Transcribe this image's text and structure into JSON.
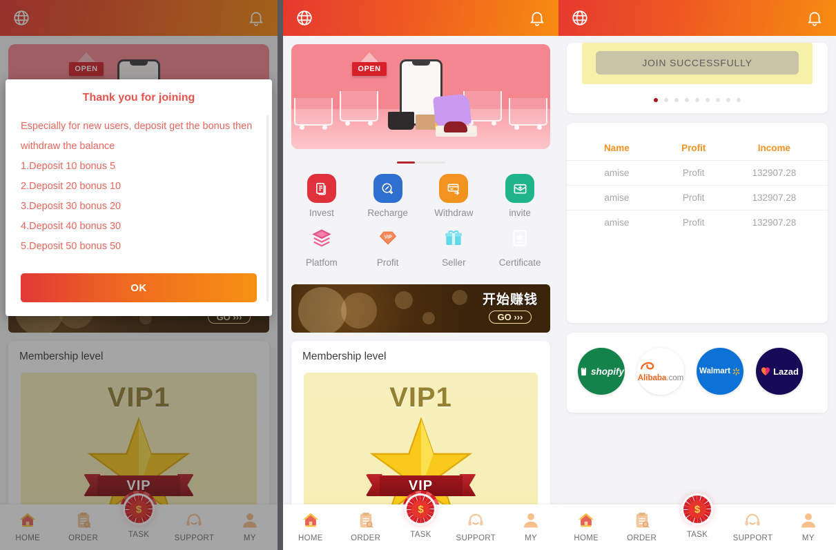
{
  "app": {
    "header": {
      "globe_icon": "globe-icon",
      "bell_icon": "bell-icon"
    },
    "bottom_nav": [
      {
        "label": "HOME",
        "icon": "home-icon"
      },
      {
        "label": "ORDER",
        "icon": "clipboard-icon"
      },
      {
        "label": "TASK",
        "icon": "poker-chip-icon"
      },
      {
        "label": "SUPPORT",
        "icon": "headset-icon"
      },
      {
        "label": "MY",
        "icon": "person-icon"
      }
    ]
  },
  "modal": {
    "title": "Thank you for joining",
    "intro": "Especially for new users, deposit get the bonus then withdraw the balance",
    "lines": [
      "1.Deposit 10 bonus 5",
      "2.Deposit 20 bonus 10",
      "3.Deposit 30 bonus 20",
      "4.Deposit 40 bonus 30",
      "5.Deposit 50 bonus 50"
    ],
    "ok_label": "OK"
  },
  "home": {
    "hero": {
      "open_sign": "OPEN",
      "alt": "pink shopping carts and phone banner"
    },
    "carousel": {
      "active_index": 0,
      "total": 2
    },
    "quick_actions": [
      {
        "label": "Invest",
        "icon": "document-stack-icon",
        "color": "#e0303c"
      },
      {
        "label": "Recharge",
        "icon": "wallet-plus-icon",
        "color": "#2f6fd0"
      },
      {
        "label": "Withdraw",
        "icon": "card-arrow-icon",
        "color": "#f2921f"
      },
      {
        "label": "invite",
        "icon": "envelope-plus-icon",
        "color": "#20b48a"
      },
      {
        "label": "Platfom",
        "icon": "layers-icon",
        "color": "#ee5f8c"
      },
      {
        "label": "Profit",
        "icon": "vip-diamond-icon",
        "color": "#f2733f"
      },
      {
        "label": "Seller",
        "icon": "gift-icon",
        "color": "#4fd1e0"
      },
      {
        "label": "Certificate",
        "icon": "certificate-icon",
        "color": "#8b6ef0"
      }
    ],
    "gold_banner": {
      "headline": "开始赚钱",
      "cta": "GO",
      "cta_arrows": "›››"
    },
    "membership": {
      "section_title": "Membership level",
      "level": "VIP1",
      "ribbon": "VIP"
    }
  },
  "join": {
    "button_label": "JOIN SUCCESSFULLY",
    "pagination": {
      "count": 9,
      "active_index": 0
    }
  },
  "ranking": {
    "columns": [
      "Name",
      "Profit",
      "Income"
    ],
    "rows": [
      [
        "amise",
        "Profit",
        "132907.28"
      ],
      [
        "amise",
        "Profit",
        "132907.28"
      ],
      [
        "amise",
        "Profit",
        "132907.28"
      ]
    ]
  },
  "partners": [
    {
      "name": "shopify",
      "label": "shopify",
      "color": "#13824b"
    },
    {
      "name": "alibaba",
      "label": "Alibaba",
      "suffix": ".com",
      "color": "#f3631c"
    },
    {
      "name": "walmart",
      "label": "Walmart",
      "color": "#0c72d6"
    },
    {
      "name": "lazada",
      "label": "Lazad",
      "color": "#170a56"
    }
  ],
  "colors": {
    "header_start": "#e5392f",
    "header_end": "#f78c10",
    "accent_orange": "#f59220",
    "accent_red": "#e8534c",
    "page_bg": "#f4f4f7"
  }
}
